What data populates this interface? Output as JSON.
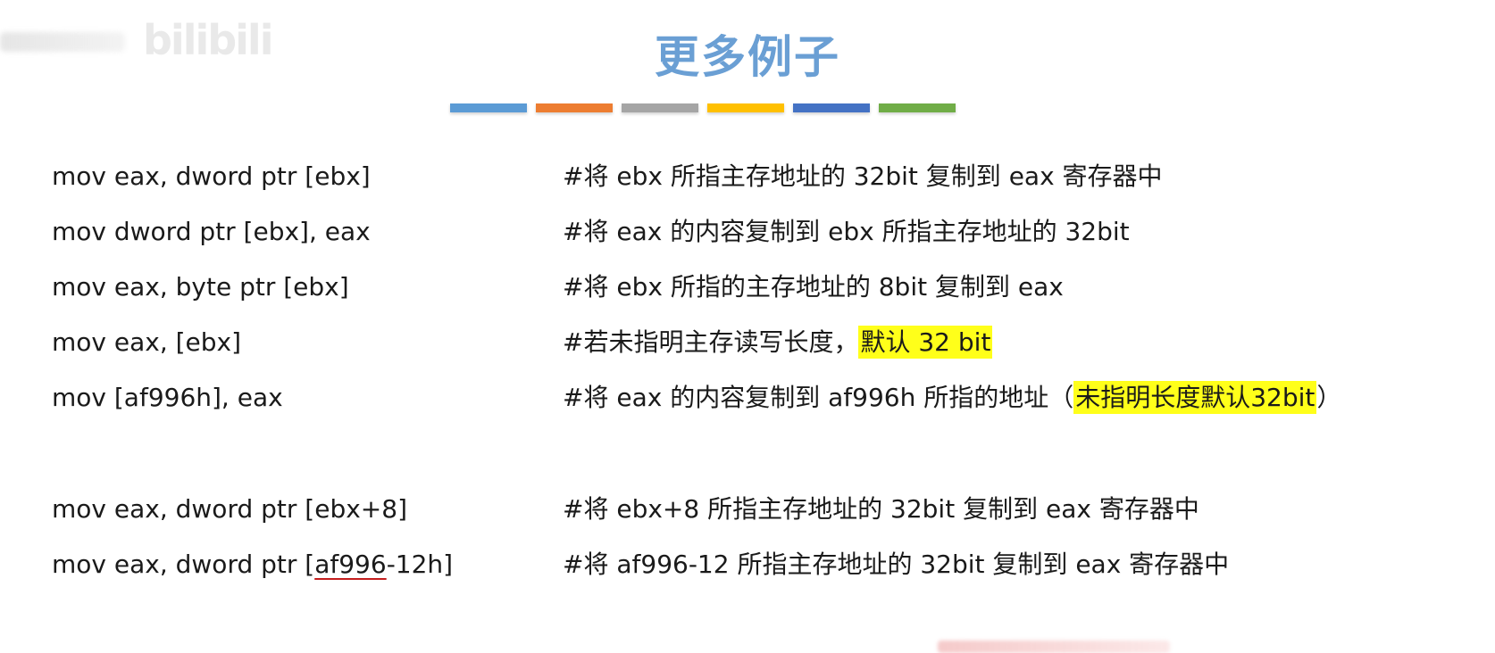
{
  "watermark": {
    "text": "bilibili"
  },
  "title": "更多例子",
  "title_bar_colors": [
    "#5b9bd5",
    "#ed7d31",
    "#a5a5a5",
    "#ffc000",
    "#4472c4",
    "#70ad47"
  ],
  "rows": [
    {
      "code": "mov eax, dword ptr [ebx]",
      "comment": "#将 ebx 所指主存地址的 32bit 复制到 eax 寄存器中"
    },
    {
      "code": "mov dword ptr [ebx], eax",
      "comment": "#将 eax 的内容复制到 ebx 所指主存地址的 32bit"
    },
    {
      "code": "mov eax, byte ptr [ebx]",
      "comment": "#将 ebx 所指的主存地址的 8bit 复制到 eax"
    },
    {
      "code": "mov eax, [ebx]",
      "comment_pre": "#若未指明主存读写长度，",
      "comment_hl": "默认 32 bit"
    },
    {
      "code": "mov [af996h], eax",
      "comment_pre": "#将 eax 的内容复制到 af996h 所指的地址（",
      "comment_hl": "未指明长度默认32bit",
      "comment_post": "）"
    },
    {
      "code": "mov eax, dword ptr [ebx+8]",
      "comment": "#将 ebx+8 所指主存地址的 32bit 复制到 eax 寄存器中"
    },
    {
      "code_pre": "mov eax, dword ptr [",
      "code_ul": "af996",
      "code_post": "-12h]",
      "comment": "#将 af996-12 所指主存地址的 32bit 复制到 eax 寄存器中"
    }
  ]
}
